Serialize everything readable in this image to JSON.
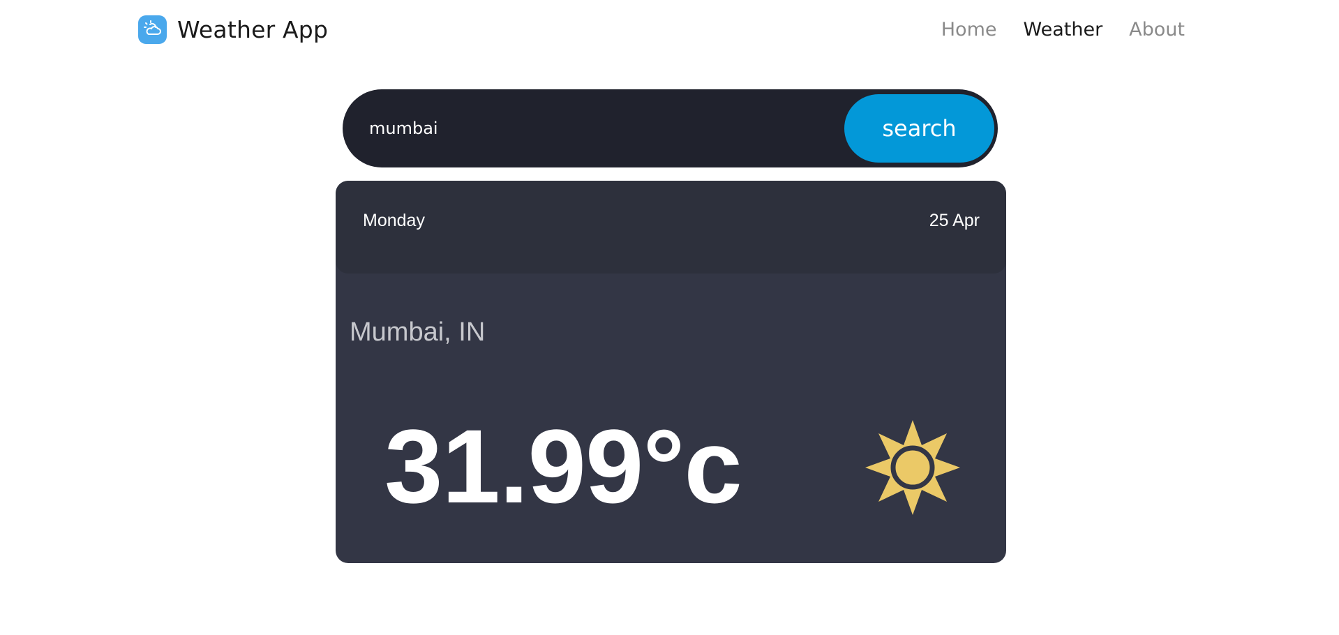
{
  "navbar": {
    "brand": "Weather App",
    "links": [
      {
        "label": "Home",
        "active": false
      },
      {
        "label": "Weather",
        "active": true
      },
      {
        "label": "About",
        "active": false
      }
    ]
  },
  "search": {
    "value": "mumbai",
    "button_label": "search"
  },
  "card": {
    "day": "Monday",
    "date": "25 Apr",
    "location": "Mumbai, IN",
    "temperature": "31.99°c",
    "condition_icon": "sun-icon"
  },
  "colors": {
    "brand_logo": "#4aa8ec",
    "search_bar": "#20222d",
    "search_button": "#0398d8",
    "card_background": "#333645",
    "card_header": "#2d303c",
    "sun": "#ebc967"
  }
}
